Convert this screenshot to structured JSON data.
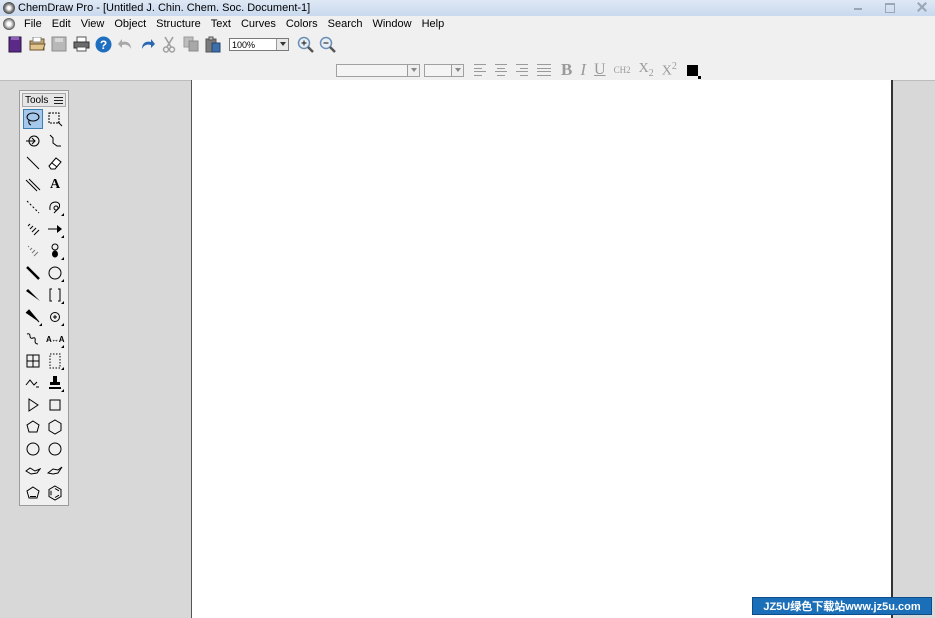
{
  "window": {
    "title": "ChemDraw Pro - [Untitled J. Chin. Chem. Soc. Document-1]"
  },
  "menu": [
    "File",
    "Edit",
    "View",
    "Object",
    "Structure",
    "Text",
    "Curves",
    "Colors",
    "Search",
    "Window",
    "Help"
  ],
  "toolbar": {
    "zoom_value": "100%",
    "format_buttons": {
      "bold": "B",
      "italic": "I",
      "underline": "U",
      "ch2": "CH2",
      "subscript_x": "X",
      "subscript_n": "2",
      "superscript_x": "X",
      "superscript_n": "2"
    },
    "accent_colors": {
      "help_button": "#1e6fc0",
      "zoom_icon": "#6a8fb5",
      "text_color": "#000000"
    }
  },
  "tools_palette": {
    "title": "Tools",
    "text_tool_label": "A",
    "mapping_tool_label": "A↔A"
  },
  "watermark": {
    "text": "JZ5U绿色下载站www.jz5u.com"
  }
}
